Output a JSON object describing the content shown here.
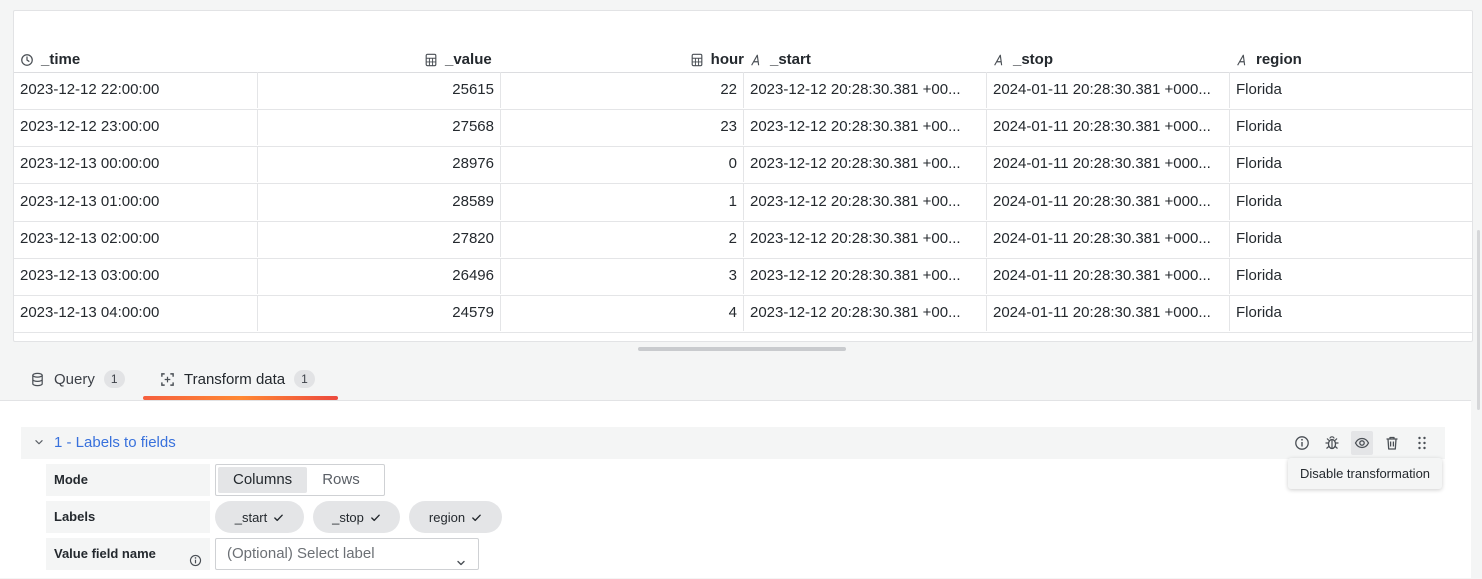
{
  "table": {
    "columns": [
      {
        "key": "time",
        "label": "_time",
        "icon": "clock-icon"
      },
      {
        "key": "value",
        "label": "_value",
        "icon": "calculator-icon"
      },
      {
        "key": "hour",
        "label": "hour",
        "icon": "calculator-icon"
      },
      {
        "key": "start",
        "label": "_start",
        "icon": "string-type-icon"
      },
      {
        "key": "stop",
        "label": "_stop",
        "icon": "string-type-icon"
      },
      {
        "key": "region",
        "label": "region",
        "icon": "string-type-icon"
      }
    ],
    "rows": [
      [
        "2023-12-12 22:00:00",
        "25615",
        "22",
        "2023-12-12 20:28:30.381 +00...",
        "2024-01-11 20:28:30.381 +000...",
        "Florida"
      ],
      [
        "2023-12-12 23:00:00",
        "27568",
        "23",
        "2023-12-12 20:28:30.381 +00...",
        "2024-01-11 20:28:30.381 +000...",
        "Florida"
      ],
      [
        "2023-12-13 00:00:00",
        "28976",
        "0",
        "2023-12-12 20:28:30.381 +00...",
        "2024-01-11 20:28:30.381 +000...",
        "Florida"
      ],
      [
        "2023-12-13 01:00:00",
        "28589",
        "1",
        "2023-12-12 20:28:30.381 +00...",
        "2024-01-11 20:28:30.381 +000...",
        "Florida"
      ],
      [
        "2023-12-13 02:00:00",
        "27820",
        "2",
        "2023-12-12 20:28:30.381 +00...",
        "2024-01-11 20:28:30.381 +000...",
        "Florida"
      ],
      [
        "2023-12-13 03:00:00",
        "26496",
        "3",
        "2023-12-12 20:28:30.381 +00...",
        "2024-01-11 20:28:30.381 +000...",
        "Florida"
      ],
      [
        "2023-12-13 04:00:00",
        "24579",
        "4",
        "2023-12-12 20:28:30.381 +00...",
        "2024-01-11 20:28:30.381 +000...",
        "Florida"
      ]
    ]
  },
  "tabs": [
    {
      "label": "Query",
      "count": "1",
      "icon": "database-icon",
      "active": false
    },
    {
      "label": "Transform data",
      "count": "1",
      "icon": "transform-icon",
      "active": true
    }
  ],
  "transform": {
    "title": "1 - Labels to fields",
    "tooltip": "Disable transformation",
    "mode": {
      "label": "Mode",
      "options": [
        "Columns",
        "Rows"
      ],
      "selected": "Columns"
    },
    "labels": {
      "label": "Labels",
      "chips": [
        "_start",
        "_stop",
        "region"
      ]
    },
    "value_field": {
      "label": "Value field name",
      "placeholder": "(Optional) Select label"
    }
  },
  "colors": {
    "accent_link": "#3871dc",
    "tab_underline_start": "#f55f3e",
    "tab_underline_end": "#ec4a3e"
  }
}
